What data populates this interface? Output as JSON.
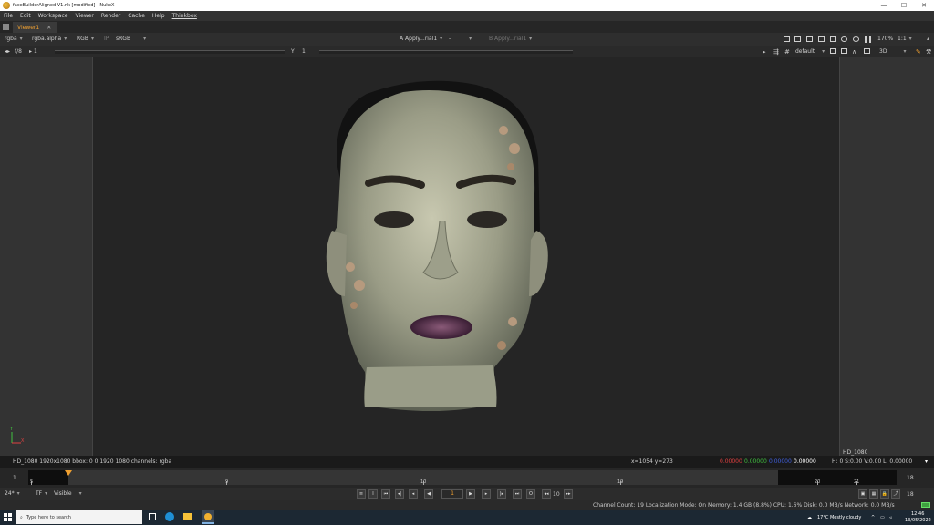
{
  "window": {
    "title": "faceBuilderAligned V1.nk [modified] - NukeX",
    "controls": [
      "—",
      "☐",
      "✕"
    ]
  },
  "menubar": {
    "items": [
      "File",
      "Edit",
      "Workspace",
      "Viewer",
      "Render",
      "Cache",
      "Help",
      "Thinkbox"
    ]
  },
  "tabs": [
    {
      "label": "Viewer1",
      "close": "✕"
    }
  ],
  "viewer_toolbar": {
    "channels": "rgba",
    "alpha": "rgba.alpha",
    "display": "RGB",
    "ip_label": "IP",
    "colorspace": "sRGB",
    "input_a_label": "A",
    "input_a": "Apply...rial1",
    "op": "-",
    "input_b_label": "B",
    "input_b": "Apply...rial1",
    "zoom": "170%",
    "ratio": "1:1"
  },
  "viewer_toolbar2": {
    "fstop": "f/8",
    "gain": "1",
    "y_label": "Y",
    "gamma": "1",
    "lut": "default",
    "mode": "3D"
  },
  "viewer": {
    "format_label": "HD_1080",
    "axis_y": "Y",
    "axis_x": "X"
  },
  "infobar": {
    "left": "HD_1080 1920x1080  bbox: 0 0 1920 1080 channels: rgba",
    "coords": "x=1054 y=273",
    "r": "0.00000",
    "g": "0.00000",
    "b": "0.00000",
    "a": "0.00000",
    "hsvl": "H:  0 S:0.00 V:0.00  L: 0.00000"
  },
  "timeline": {
    "start": "1",
    "end": "18",
    "labels": [
      "5",
      "9",
      "10",
      "15",
      "19",
      "20",
      "21"
    ],
    "black_start_label": "5"
  },
  "playbar": {
    "fps": "24*",
    "tf": "TF",
    "visible": "Visible",
    "frame": "1",
    "increment": "10",
    "end_frame": "18"
  },
  "statusbar": {
    "text": "Channel Count: 19  Localization Mode: On  Memory: 1.4 GB (8.8%)  CPU: 1.6%  Disk: 0.0 MB/s  Network: 0.0 MB/s"
  },
  "taskbar": {
    "search_placeholder": "Type here to search",
    "weather": "17°C  Mostly cloudy",
    "time": "12:46",
    "date": "13/05/2022"
  },
  "colors": {
    "accent": "#f0a030",
    "red": "#e04040",
    "green": "#40c040",
    "blue": "#4060e0"
  }
}
